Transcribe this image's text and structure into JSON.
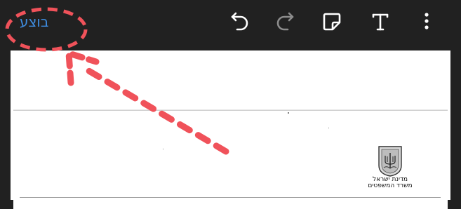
{
  "toolbar": {
    "done_label": "בוצע",
    "icons": [
      "undo-icon",
      "redo-icon",
      "sticky-note-icon",
      "text-tool-icon",
      "more-options-icon"
    ]
  },
  "document": {
    "org_line1": "מדינת ישראל",
    "org_line2": "משרד המשפטים"
  },
  "colors": {
    "toolbar_bg": "#212121",
    "accent": "#3f8de0",
    "annotation": "#f0525a",
    "icon": "#ffffff",
    "icon_disabled": "#8c8c8c"
  }
}
